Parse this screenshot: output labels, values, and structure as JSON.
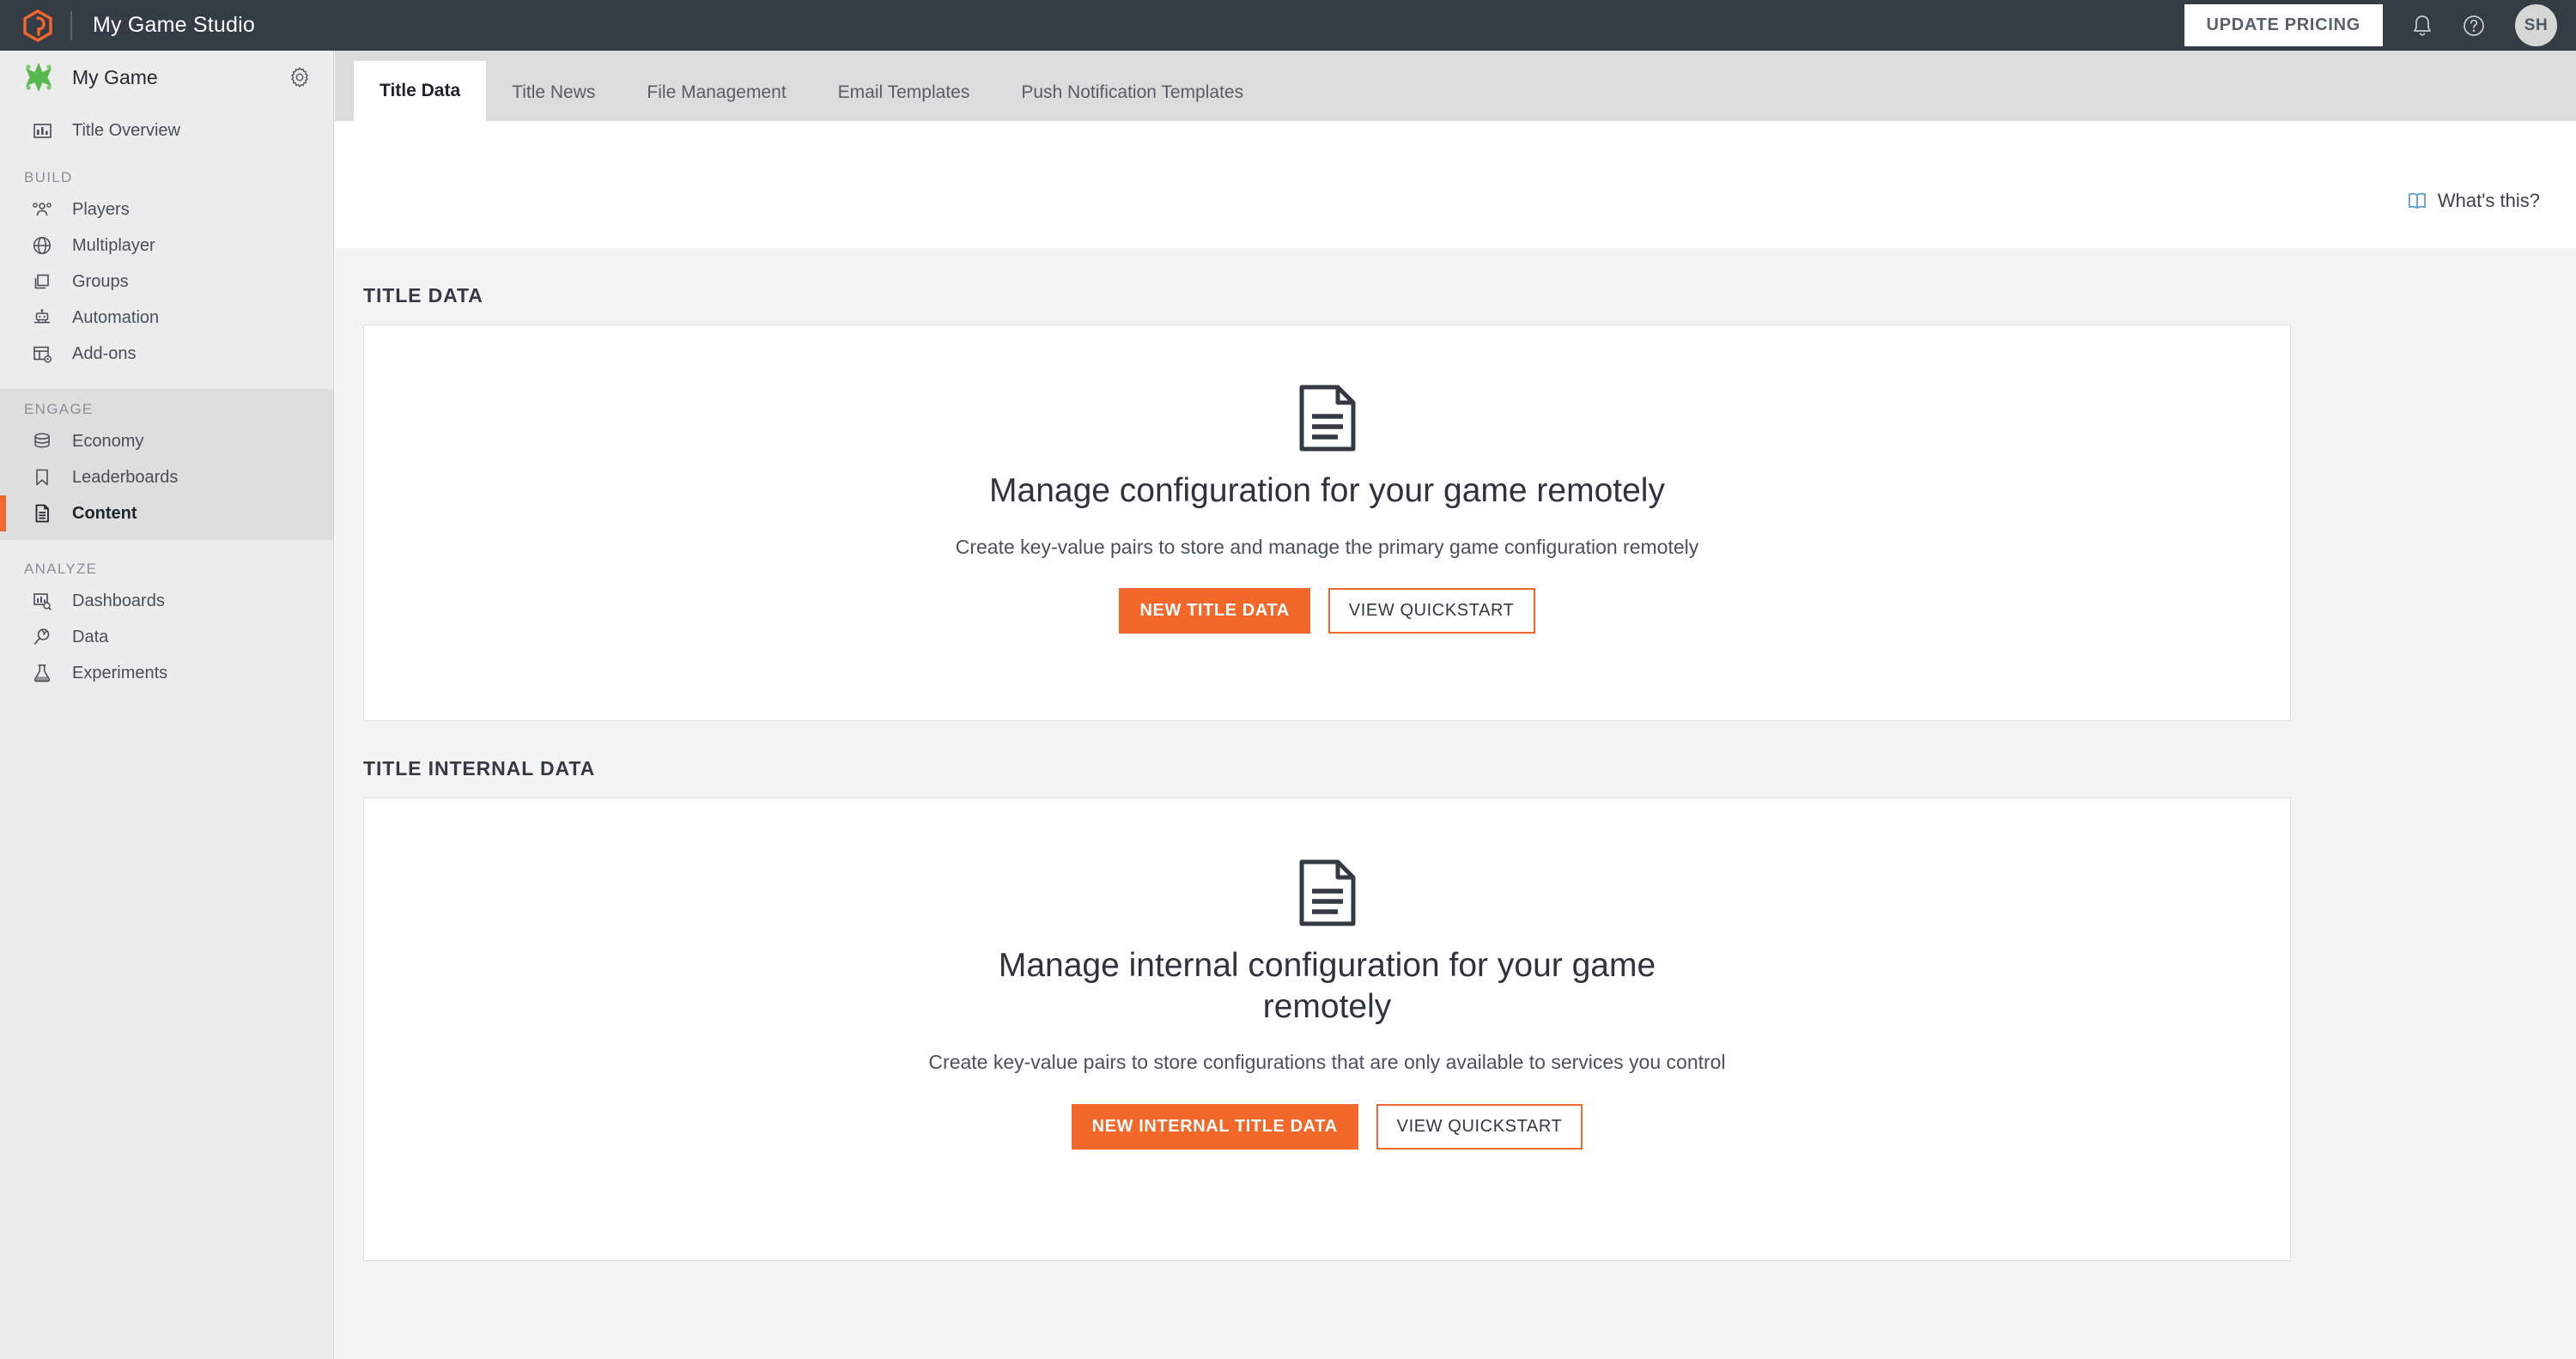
{
  "header": {
    "brand_logo_icon": "hexagon-logo-icon",
    "studio_title": "My Game Studio",
    "update_pricing_label": "UPDATE PRICING",
    "notifications_icon": "bell-icon",
    "help_icon": "question-circle-icon",
    "avatar_initials": "SH"
  },
  "sidebar": {
    "game_name": "My Game",
    "game_logo_icon": "green-star-game-icon",
    "settings_icon": "gear-icon",
    "top_items": [
      {
        "label": "Title Overview",
        "icon": "bar-chart-icon",
        "active": false
      }
    ],
    "groups": [
      {
        "title": "BUILD",
        "highlight": false,
        "items": [
          {
            "label": "Players",
            "icon": "people-icon",
            "active": false
          },
          {
            "label": "Multiplayer",
            "icon": "globe-icon",
            "active": false
          },
          {
            "label": "Groups",
            "icon": "layers-icon",
            "active": false
          },
          {
            "label": "Automation",
            "icon": "robot-icon",
            "active": false
          },
          {
            "label": "Add-ons",
            "icon": "addons-icon",
            "active": false
          }
        ]
      },
      {
        "title": "ENGAGE",
        "highlight": true,
        "items": [
          {
            "label": "Economy",
            "icon": "coins-stack-icon",
            "active": false
          },
          {
            "label": "Leaderboards",
            "icon": "bookmark-icon",
            "active": false
          },
          {
            "label": "Content",
            "icon": "document-icon",
            "active": true
          }
        ]
      },
      {
        "title": "ANALYZE",
        "highlight": false,
        "items": [
          {
            "label": "Dashboards",
            "icon": "dashboard-search-icon",
            "active": false
          },
          {
            "label": "Data",
            "icon": "plug-icon",
            "active": false
          },
          {
            "label": "Experiments",
            "icon": "flask-icon",
            "active": false
          }
        ]
      }
    ]
  },
  "tabs": [
    {
      "label": "Title Data",
      "active": true
    },
    {
      "label": "Title News",
      "active": false
    },
    {
      "label": "File Management",
      "active": false
    },
    {
      "label": "Email Templates",
      "active": false
    },
    {
      "label": "Push Notification Templates",
      "active": false
    }
  ],
  "whats_this": {
    "label": "What's this?",
    "icon": "book-icon"
  },
  "sections": [
    {
      "title": "TITLE DATA",
      "empty_state": {
        "icon": "document-icon",
        "heading": "Manage configuration for your game remotely",
        "description": "Create key-value pairs to store and manage the primary game configuration remotely",
        "primary_button": "NEW TITLE DATA",
        "secondary_button": "VIEW QUICKSTART"
      }
    },
    {
      "title": "TITLE INTERNAL DATA",
      "empty_state": {
        "icon": "document-icon",
        "heading": "Manage internal configuration for your game remotely",
        "description": "Create key-value pairs to store configurations that are only available to services you control",
        "primary_button": "NEW INTERNAL TITLE DATA",
        "secondary_button": "VIEW QUICKSTART"
      }
    }
  ],
  "colors": {
    "accent_orange": "#f2682a",
    "header_dark": "#343d46",
    "sidebar_bg": "#ececec",
    "content_bg": "#f4f4f4",
    "link_blue": "#4a90e2",
    "game_logo_green": "#5cb85c"
  }
}
